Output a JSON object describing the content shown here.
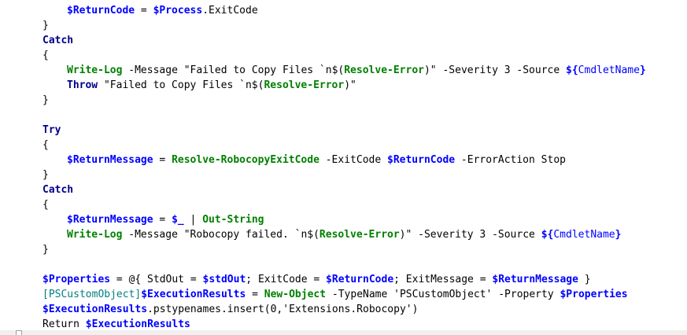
{
  "code_lines": [
    {
      "indent": 2,
      "tokens": [
        {
          "t": "$ReturnCode",
          "c": "varb"
        },
        {
          "t": " = ",
          "c": "plain"
        },
        {
          "t": "$Process",
          "c": "varb"
        },
        {
          "t": ".ExitCode",
          "c": "plain"
        }
      ]
    },
    {
      "indent": 1,
      "tokens": [
        {
          "t": "}",
          "c": "plain"
        }
      ]
    },
    {
      "indent": 1,
      "tokens": [
        {
          "t": "Catch",
          "c": "kw"
        }
      ]
    },
    {
      "indent": 1,
      "tokens": [
        {
          "t": "{",
          "c": "plain"
        }
      ]
    },
    {
      "indent": 2,
      "tokens": [
        {
          "t": "Write-Log",
          "c": "cmdg"
        },
        {
          "t": " -Message ",
          "c": "plain"
        },
        {
          "t": "\"Failed to Copy Files `n$(",
          "c": "plain"
        },
        {
          "t": "Resolve-Error",
          "c": "cmdg"
        },
        {
          "t": ")\"",
          "c": "plain"
        },
        {
          "t": " -Severity ",
          "c": "plain"
        },
        {
          "t": "3",
          "c": "plain"
        },
        {
          "t": " -Source ",
          "c": "plain"
        },
        {
          "t": "${",
          "c": "varb"
        },
        {
          "t": "CmdletName",
          "c": "cmd"
        },
        {
          "t": "}",
          "c": "varb"
        }
      ]
    },
    {
      "indent": 2,
      "tokens": [
        {
          "t": "Throw",
          "c": "kw"
        },
        {
          "t": " \"Failed to Copy Files `n$(",
          "c": "plain"
        },
        {
          "t": "Resolve-Error",
          "c": "cmdg"
        },
        {
          "t": ")\"",
          "c": "plain"
        }
      ]
    },
    {
      "indent": 1,
      "tokens": [
        {
          "t": "}",
          "c": "plain"
        }
      ]
    },
    {
      "indent": 0,
      "tokens": []
    },
    {
      "indent": 1,
      "tokens": [
        {
          "t": "Try",
          "c": "kw"
        }
      ]
    },
    {
      "indent": 1,
      "tokens": [
        {
          "t": "{",
          "c": "plain"
        }
      ]
    },
    {
      "indent": 2,
      "tokens": [
        {
          "t": "$ReturnMessage",
          "c": "varb"
        },
        {
          "t": " = ",
          "c": "plain"
        },
        {
          "t": "Resolve-RobocopyExitCode",
          "c": "cmdg"
        },
        {
          "t": " -ExitCode ",
          "c": "plain"
        },
        {
          "t": "$ReturnCode",
          "c": "varb"
        },
        {
          "t": " -ErrorAction Stop",
          "c": "plain"
        }
      ]
    },
    {
      "indent": 1,
      "tokens": [
        {
          "t": "}",
          "c": "plain"
        }
      ]
    },
    {
      "indent": 1,
      "tokens": [
        {
          "t": "Catch",
          "c": "kw"
        }
      ]
    },
    {
      "indent": 1,
      "tokens": [
        {
          "t": "{",
          "c": "plain"
        }
      ]
    },
    {
      "indent": 2,
      "tokens": [
        {
          "t": "$ReturnMessage",
          "c": "varb"
        },
        {
          "t": " = ",
          "c": "plain"
        },
        {
          "t": "$_",
          "c": "varb"
        },
        {
          "t": " | ",
          "c": "plain"
        },
        {
          "t": "Out-String",
          "c": "cmdg"
        }
      ]
    },
    {
      "indent": 2,
      "tokens": [
        {
          "t": "Write-Log",
          "c": "cmdg"
        },
        {
          "t": " -Message ",
          "c": "plain"
        },
        {
          "t": "\"Robocopy failed. `n$(",
          "c": "plain"
        },
        {
          "t": "Resolve-Error",
          "c": "cmdg"
        },
        {
          "t": ")\"",
          "c": "plain"
        },
        {
          "t": " -Severity ",
          "c": "plain"
        },
        {
          "t": "3",
          "c": "plain"
        },
        {
          "t": " -Source ",
          "c": "plain"
        },
        {
          "t": "${",
          "c": "varb"
        },
        {
          "t": "CmdletName",
          "c": "cmd"
        },
        {
          "t": "}",
          "c": "varb"
        }
      ]
    },
    {
      "indent": 1,
      "tokens": [
        {
          "t": "}",
          "c": "plain"
        }
      ]
    },
    {
      "indent": 0,
      "tokens": []
    },
    {
      "indent": 1,
      "tokens": [
        {
          "t": "$Properties",
          "c": "varb"
        },
        {
          "t": " = @{ StdOut = ",
          "c": "plain"
        },
        {
          "t": "$stdOut",
          "c": "varb"
        },
        {
          "t": "; ExitCode = ",
          "c": "plain"
        },
        {
          "t": "$ReturnCode",
          "c": "varb"
        },
        {
          "t": "; ExitMessage = ",
          "c": "plain"
        },
        {
          "t": "$ReturnMessage",
          "c": "varb"
        },
        {
          "t": " }",
          "c": "plain"
        }
      ]
    },
    {
      "indent": 1,
      "tokens": [
        {
          "t": "[PSCustomObject]",
          "c": "type"
        },
        {
          "t": "$ExecutionResults",
          "c": "varb"
        },
        {
          "t": " = ",
          "c": "plain"
        },
        {
          "t": "New-Object",
          "c": "cmdg"
        },
        {
          "t": " -TypeName ",
          "c": "plain"
        },
        {
          "t": "'PSCustomObject'",
          "c": "plain"
        },
        {
          "t": " -Property ",
          "c": "plain"
        },
        {
          "t": "$Properties",
          "c": "varb"
        }
      ]
    },
    {
      "indent": 1,
      "tokens": [
        {
          "t": "$ExecutionResults",
          "c": "varb"
        },
        {
          "t": ".pstypenames.insert(0,'Extensions.Robocopy')",
          "c": "plain"
        }
      ]
    },
    {
      "indent": 1,
      "tokens": [
        {
          "t": "Return ",
          "c": "plain"
        },
        {
          "t": "$ExecutionResults",
          "c": "varb"
        }
      ]
    }
  ]
}
